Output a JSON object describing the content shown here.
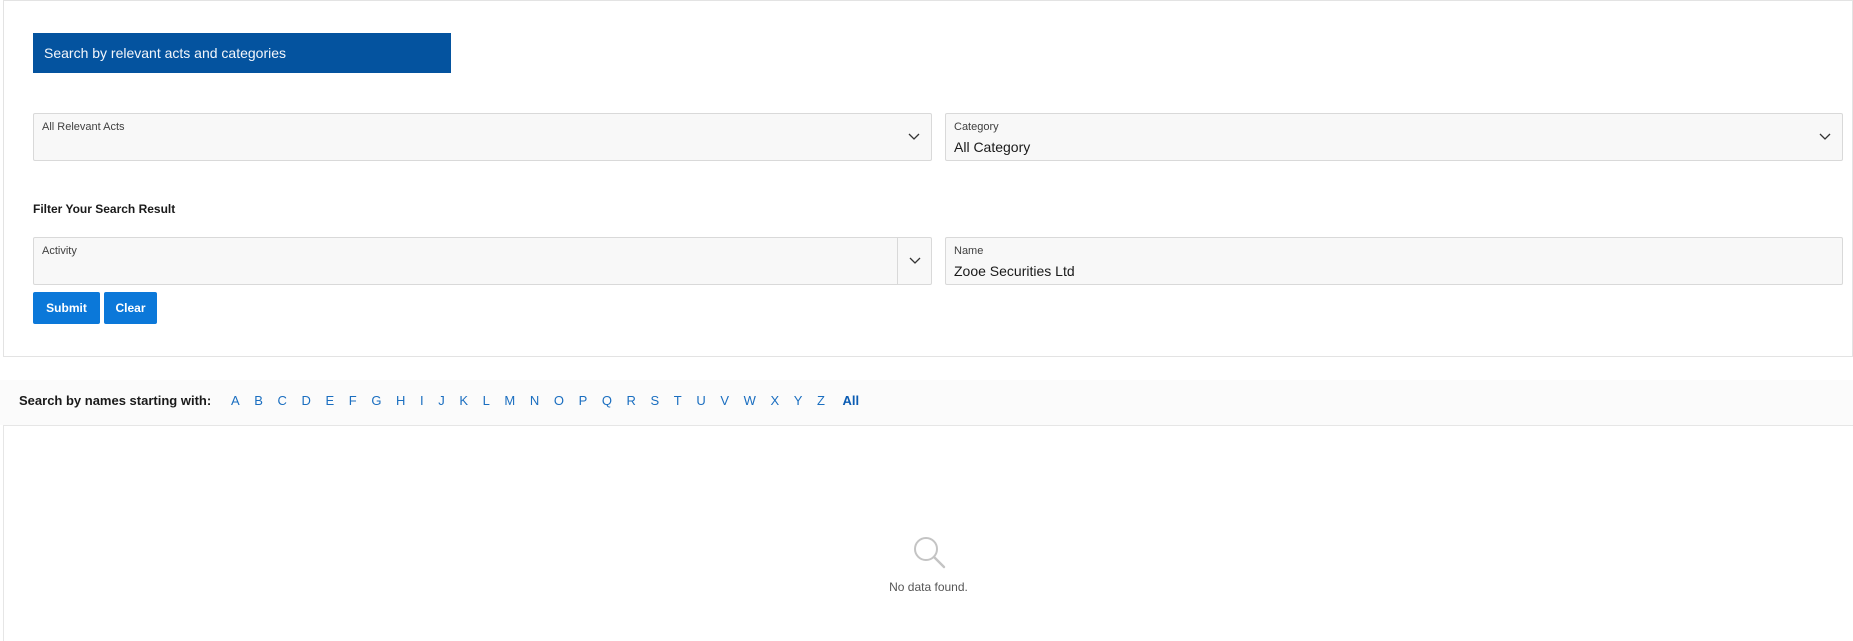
{
  "header": {
    "title": "Search by relevant acts and categories"
  },
  "filters": {
    "relevant_acts": {
      "label": "All Relevant Acts",
      "value": ""
    },
    "category": {
      "label": "Category",
      "value": "All Category"
    },
    "section_title": "Filter Your Search Result",
    "activity": {
      "label": "Activity",
      "value": ""
    },
    "name": {
      "label": "Name",
      "value": "Zooe Securities Ltd"
    }
  },
  "buttons": {
    "submit": "Submit",
    "clear": "Clear"
  },
  "alphabet": {
    "title": "Search by names starting with:",
    "letters": [
      "A",
      "B",
      "C",
      "D",
      "E",
      "F",
      "G",
      "H",
      "I",
      "J",
      "K",
      "L",
      "M",
      "N",
      "O",
      "P",
      "Q",
      "R",
      "S",
      "T",
      "U",
      "V",
      "W",
      "X",
      "Y",
      "Z"
    ],
    "all": "All"
  },
  "results": {
    "empty_message": "No data found.",
    "empty_icon": "search-icon"
  },
  "colors": {
    "header_bg": "#04539f",
    "button_bg": "#0b78d9",
    "link": "#1a6ec0"
  }
}
